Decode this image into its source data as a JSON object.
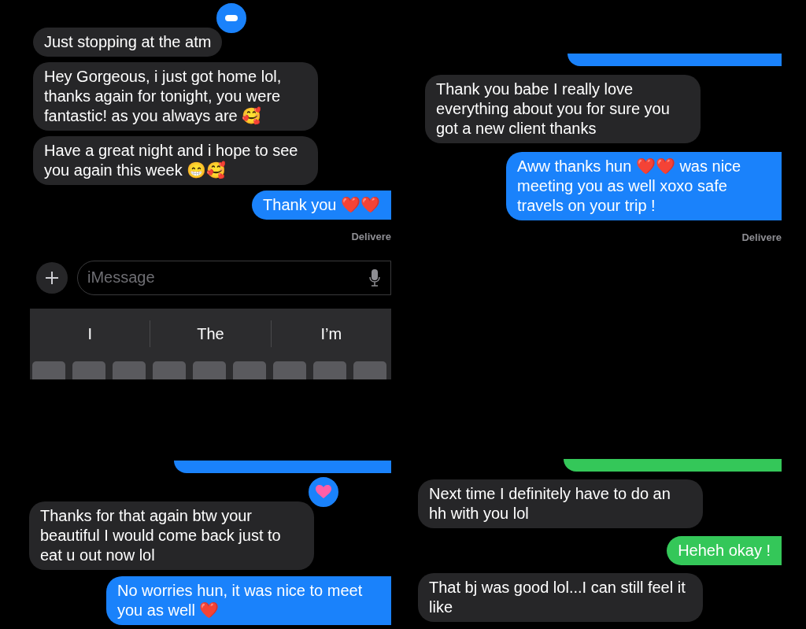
{
  "panels": [
    {
      "messages": [
        {
          "kind": "received",
          "text": "Just stopping at the atm",
          "tapback": {
            "kind": "other"
          }
        },
        {
          "kind": "received",
          "text": "Hey Gorgeous, i just got home lol, thanks again for tonight, you were fantastic! as you always are 🥰"
        },
        {
          "kind": "received",
          "text": "Have a great night and i hope to see you again this week 😁🥰"
        },
        {
          "kind": "sent",
          "color": "#1a82fb",
          "text": "Thank you ❤️❤️"
        }
      ],
      "delivered": "Delivere",
      "composer": {
        "placeholder": "iMessage"
      },
      "keyboard": {
        "suggestions": [
          "I",
          "The",
          "I’m"
        ]
      }
    },
    {
      "messages": [
        {
          "kind": "partial",
          "color": "#1a82fb"
        },
        {
          "kind": "received",
          "text": "Thank you babe I really love everything about you for sure you got a new client thanks"
        },
        {
          "kind": "sent",
          "color": "#1a82fb",
          "text": "Aww thanks hun ❤️❤️ was nice meeting you as well xoxo safe travels on your trip !"
        }
      ],
      "delivered": "Delivere"
    },
    {
      "messages": [
        {
          "kind": "partial",
          "color": "#1a82fb"
        },
        {
          "kind": "received",
          "text": "Thanks for that again btw your beautiful I would come back just to eat u out now lol",
          "tapback": {
            "kind": "heart"
          }
        },
        {
          "kind": "sent",
          "color": "#1a82fb",
          "text": "No worries hun, it was nice to meet you as well ❤️"
        }
      ]
    },
    {
      "messages": [
        {
          "kind": "partial",
          "color": "#34c759"
        },
        {
          "kind": "received",
          "text": "Next time I definitely have to do an hh with you lol"
        },
        {
          "kind": "sent",
          "color": "#34c759",
          "text": "Heheh okay !"
        },
        {
          "kind": "received",
          "text": "That bj was good lol...I can still feel it like"
        }
      ]
    }
  ]
}
